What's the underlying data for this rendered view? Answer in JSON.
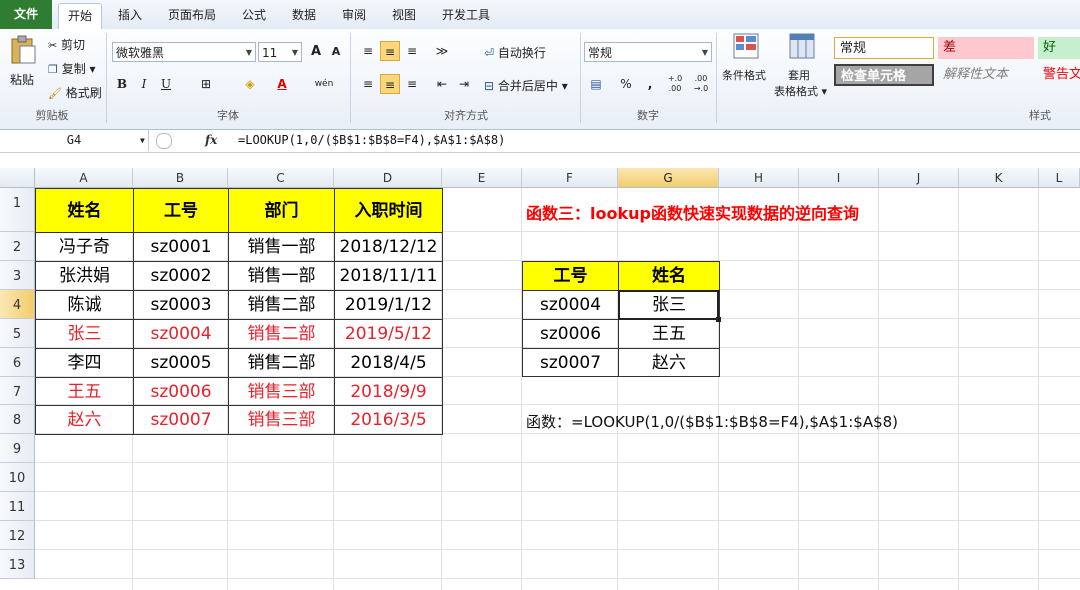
{
  "tabs": [
    "文件",
    "开始",
    "插入",
    "页面布局",
    "公式",
    "数据",
    "审阅",
    "视图",
    "开发工具"
  ],
  "ribbon": {
    "clipboard": {
      "paste": "粘贴",
      "cut": "剪切",
      "copy": "复制 ▾",
      "format_painter": "格式刷",
      "title": "剪贴板"
    },
    "font": {
      "name": "微软雅黑",
      "size": "11",
      "grow": "A",
      "shrink": "A",
      "bold": "B",
      "italic": "I",
      "underline": "U",
      "wen": "wén",
      "title": "字体"
    },
    "align": {
      "wrap": "自动换行",
      "merge": "合并后居中 ▾",
      "title": "对齐方式"
    },
    "number": {
      "format": "常规",
      "percent": "%",
      "comma": ",",
      "inc": "+.0 .00",
      "dec": ".00 →.0",
      "title": "数字"
    },
    "styles": {
      "cond": "条件格式",
      "table1": "套用",
      "table2": "表格格式 ▾",
      "normal": "常规",
      "bad": "差",
      "good": "好",
      "check": "检查单元格",
      "explain": "解释性文本",
      "warn": "警告文",
      "title": "样式"
    }
  },
  "formula_bar": {
    "name_box": "G4",
    "fx": "fx",
    "formula": "=LOOKUP(1,0/($B$1:$B$8=F4),$A$1:$A$8)"
  },
  "columns": [
    "A",
    "B",
    "C",
    "D",
    "E",
    "F",
    "G",
    "H",
    "I",
    "J",
    "K",
    "L"
  ],
  "rows": [
    "1",
    "2",
    "3",
    "4",
    "5",
    "6",
    "7",
    "8",
    "9",
    "10",
    "11",
    "12",
    "13"
  ],
  "main_table": {
    "headers": [
      "姓名",
      "工号",
      "部门",
      "入职时间"
    ],
    "rows": [
      {
        "cells": [
          "冯子奇",
          "sz0001",
          "销售一部",
          "2018/12/12"
        ],
        "highlight": false
      },
      {
        "cells": [
          "张洪娟",
          "sz0002",
          "销售一部",
          "2018/11/11"
        ],
        "highlight": false
      },
      {
        "cells": [
          "陈诚",
          "sz0003",
          "销售二部",
          "2019/1/12"
        ],
        "highlight": false
      },
      {
        "cells": [
          "张三",
          "sz0004",
          "销售二部",
          "2019/5/12"
        ],
        "highlight": true
      },
      {
        "cells": [
          "李四",
          "sz0005",
          "销售二部",
          "2018/4/5"
        ],
        "highlight": false
      },
      {
        "cells": [
          "王五",
          "sz0006",
          "销售三部",
          "2018/9/9"
        ],
        "highlight": true
      },
      {
        "cells": [
          "赵六",
          "sz0007",
          "销售三部",
          "2016/3/5"
        ],
        "highlight": true
      }
    ]
  },
  "lookup_title": "函数三：lookup函数快速实现数据的逆向查询",
  "lookup_table": {
    "headers": [
      "工号",
      "姓名"
    ],
    "rows": [
      [
        "sz0004",
        "张三"
      ],
      [
        "sz0006",
        "王五"
      ],
      [
        "sz0007",
        "赵六"
      ]
    ]
  },
  "formula_note": "函数：=LOOKUP(1,0/($B$1:$B$8=F4),$A$1:$A$8)",
  "colors": {
    "header_fill": "#ffff00",
    "highlight_text": "#e8212a",
    "file_tab": "#2e7d32"
  }
}
